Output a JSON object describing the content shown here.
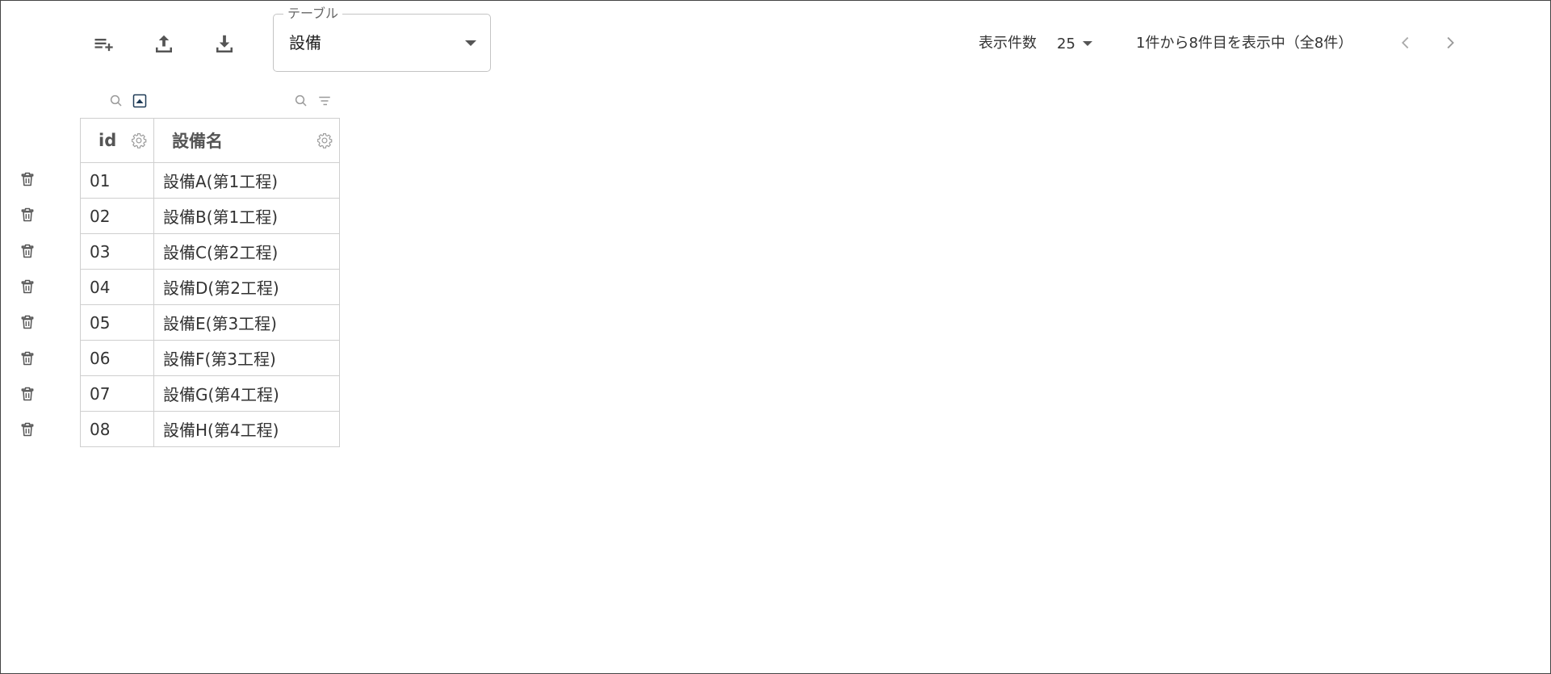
{
  "toolbar": {
    "add_row_icon": "playlist-add-icon",
    "upload_icon": "upload-icon",
    "download_icon": "download-icon"
  },
  "table_select": {
    "label": "テーブル",
    "value": "設備"
  },
  "pagination": {
    "rows_label": "表示件数",
    "rows_per_page": "25",
    "range_text": "1件から8件目を表示中（全8件）"
  },
  "table": {
    "columns": [
      {
        "label": "id"
      },
      {
        "label": "設備名"
      }
    ],
    "rows": [
      {
        "id": "01",
        "name": "設備A(第1工程)"
      },
      {
        "id": "02",
        "name": "設備B(第1工程)"
      },
      {
        "id": "03",
        "name": "設備C(第2工程)"
      },
      {
        "id": "04",
        "name": "設備D(第2工程)"
      },
      {
        "id": "05",
        "name": "設備E(第3工程)"
      },
      {
        "id": "06",
        "name": "設備F(第3工程)"
      },
      {
        "id": "07",
        "name": "設備G(第4工程)"
      },
      {
        "id": "08",
        "name": "設備H(第4工程)"
      }
    ]
  },
  "colors": {
    "accent": "#1f3b57",
    "icon": "#555555",
    "icon_light": "#9a9a9a",
    "border": "#cfcfcf"
  }
}
